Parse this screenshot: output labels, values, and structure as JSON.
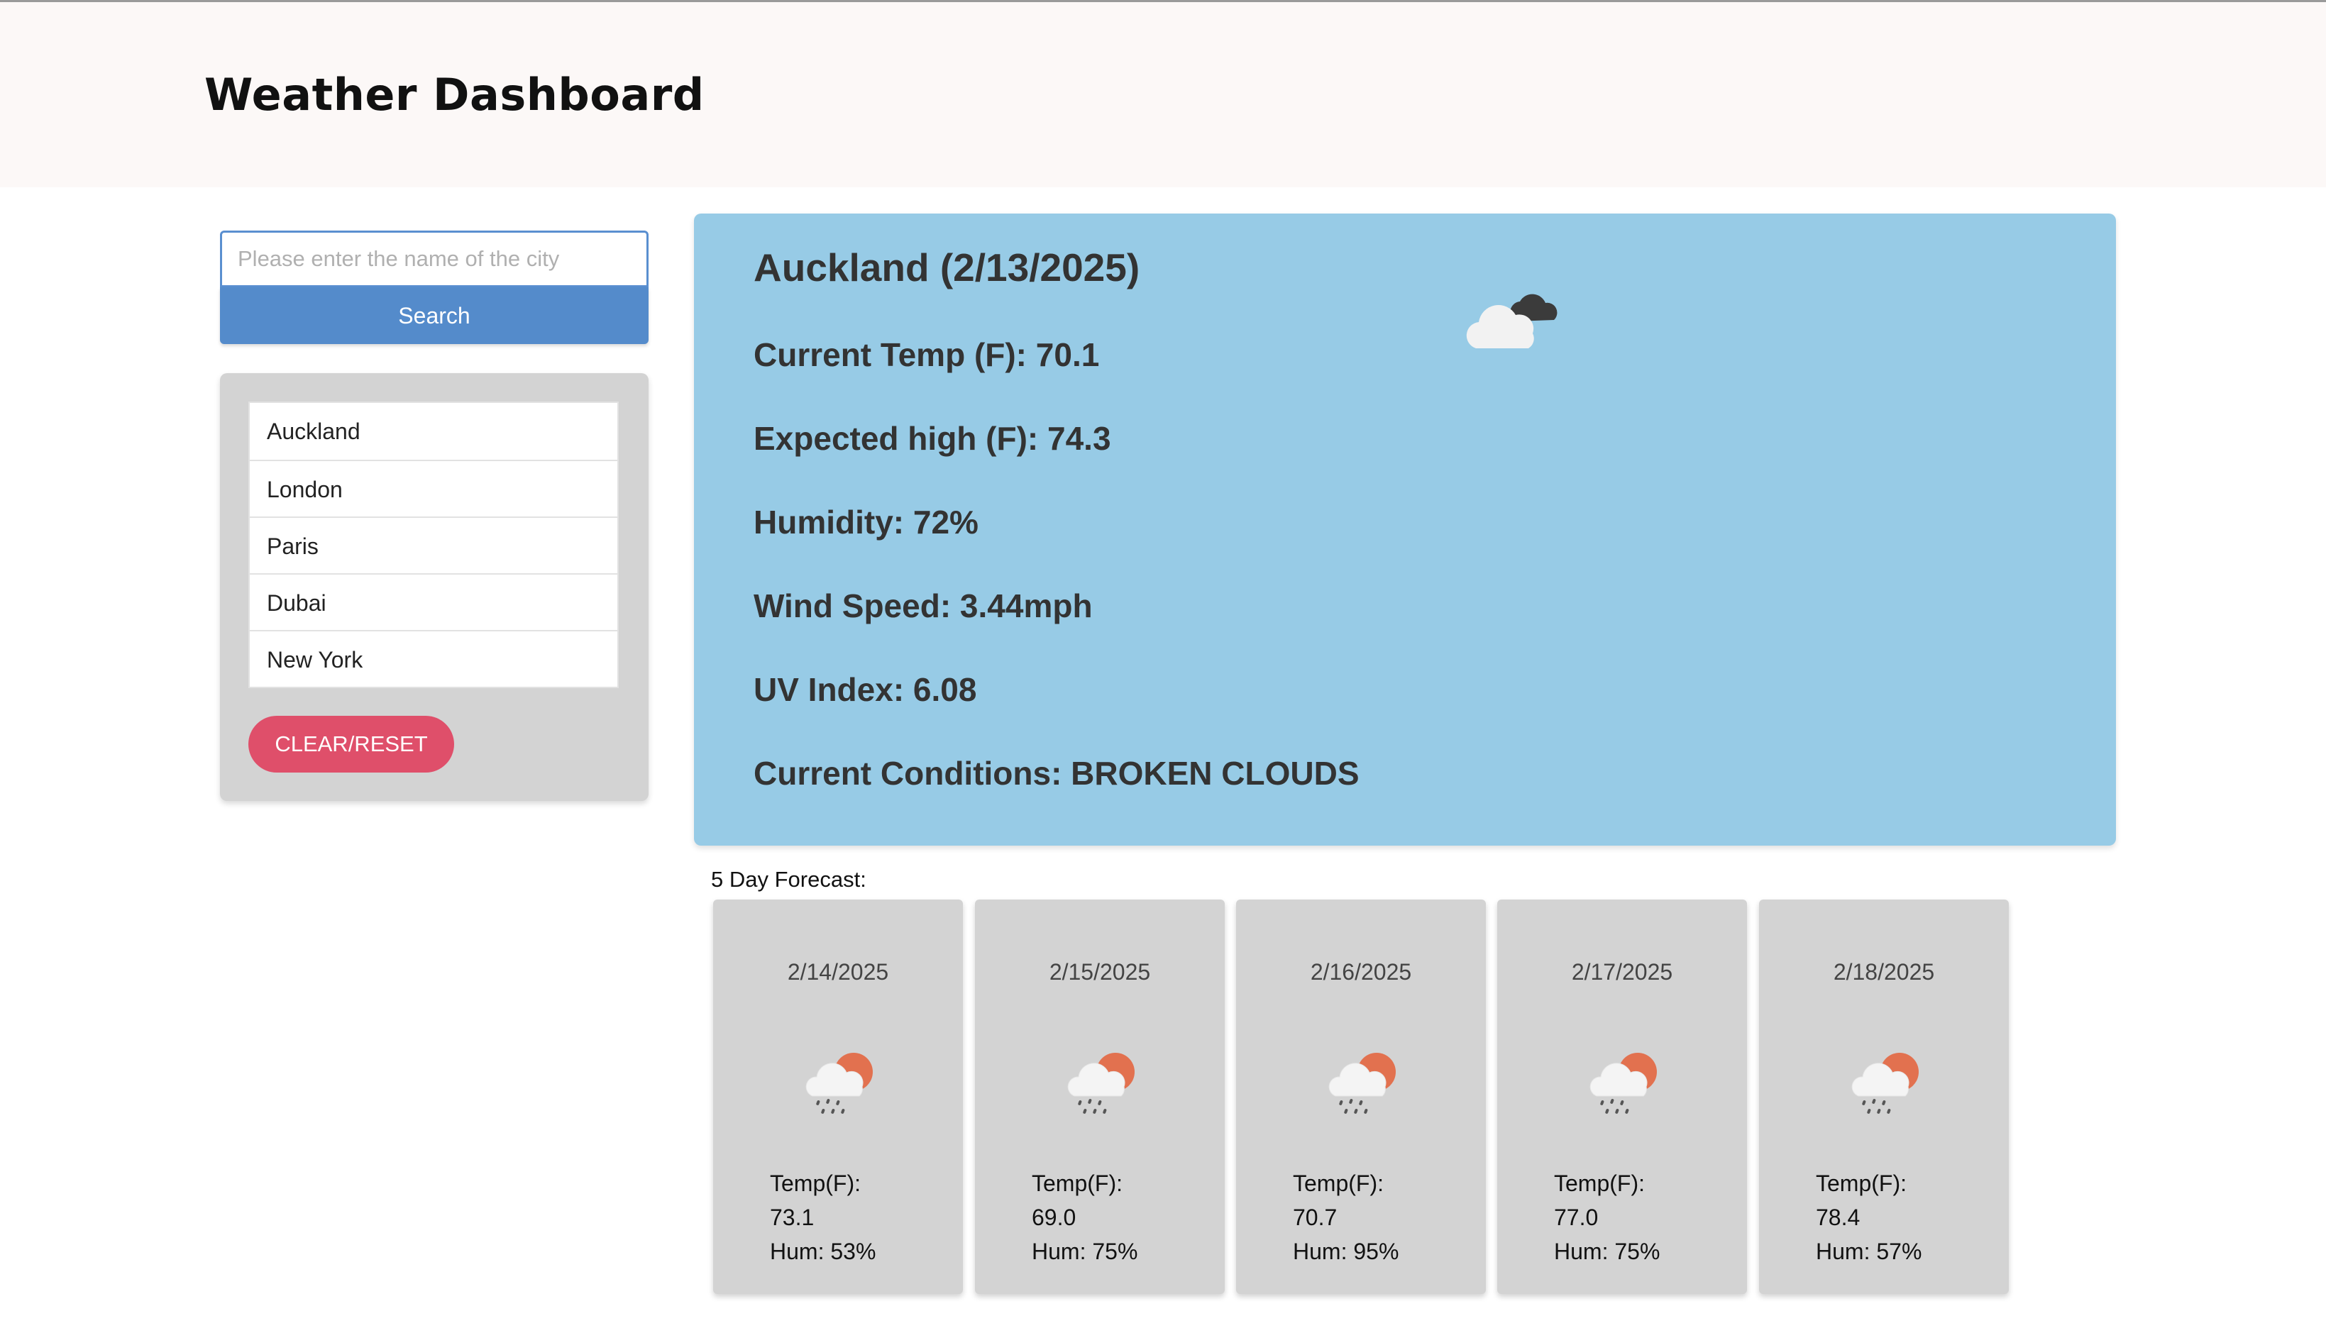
{
  "header": {
    "title": "Weather Dashboard"
  },
  "search": {
    "placeholder": "Please enter the name of the city",
    "value": "",
    "button_label": "Search"
  },
  "history": {
    "cities": [
      "Auckland",
      "London",
      "Paris",
      "Dubai",
      "New York"
    ],
    "clear_label": "CLEAR/RESET"
  },
  "current": {
    "title": "Auckland (2/13/2025)",
    "temp": "Current Temp (F): 70.1",
    "high": "Expected high (F): 74.3",
    "humidity": "Humidity: 72%",
    "wind": "Wind Speed: 3.44mph",
    "uv": "UV Index: 6.08",
    "conditions": "Current Conditions: BROKEN CLOUDS",
    "icon": "broken-clouds-icon"
  },
  "forecast": {
    "label": "5 Day Forecast:",
    "days": [
      {
        "date": "2/14/2025",
        "temp_label": "Temp(F):",
        "temp": "73.1",
        "hum": "Hum: 53%",
        "icon": "rain-sun-icon"
      },
      {
        "date": "2/15/2025",
        "temp_label": "Temp(F):",
        "temp": "69.0",
        "hum": "Hum: 75%",
        "icon": "rain-sun-icon"
      },
      {
        "date": "2/16/2025",
        "temp_label": "Temp(F):",
        "temp": "70.7",
        "hum": "Hum: 95%",
        "icon": "rain-sun-icon"
      },
      {
        "date": "2/17/2025",
        "temp_label": "Temp(F):",
        "temp": "77.0",
        "hum": "Hum: 75%",
        "icon": "rain-sun-icon"
      },
      {
        "date": "2/18/2025",
        "temp_label": "Temp(F):",
        "temp": "78.4",
        "hum": "Hum: 57%",
        "icon": "rain-sun-icon"
      }
    ]
  },
  "colors": {
    "header_bg": "#fcf8f7",
    "search_button": "#548bcb",
    "clear_button": "#df4f6a",
    "current_card": "#97cbe6",
    "panel_gray": "#d3d3d3",
    "sun": "#e2714f"
  }
}
